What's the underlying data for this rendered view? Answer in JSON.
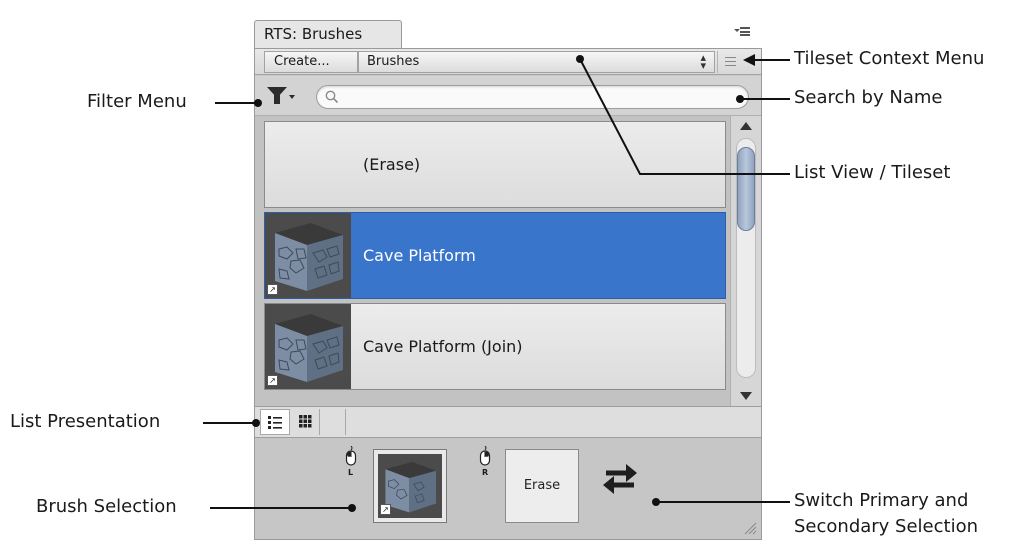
{
  "panel": {
    "tab_title": "RTS: Brushes",
    "toolbar": {
      "create_label": "Create...",
      "tileset_value": "Brushes",
      "select_arrows": "▴▾"
    },
    "search": {
      "placeholder": "",
      "value": ""
    },
    "list_items": [
      {
        "label": "(Erase)",
        "has_thumbnail": false,
        "selected": false
      },
      {
        "label": "Cave Platform",
        "has_thumbnail": true,
        "selected": true
      },
      {
        "label": "Cave Platform (Join)",
        "has_thumbnail": true,
        "selected": false
      }
    ],
    "presentation": {
      "active": "list"
    },
    "brush_selection": {
      "left_mouse": "L",
      "right_mouse": "R",
      "secondary_label": "Erase"
    },
    "thumbnail_badge": "↗"
  },
  "annotations": {
    "tileset_context_menu": "Tileset Context Menu",
    "filter_menu": "Filter Menu",
    "search_by_name": "Search by Name",
    "list_view_tileset": "List View / Tileset",
    "list_presentation": "List Presentation",
    "brush_selection": "Brush Selection",
    "switch_line1": "Switch Primary and",
    "switch_line2": "Secondary Selection"
  },
  "colors": {
    "selected": "#3a75cc",
    "panel_bg": "#c8c8c8",
    "accent_thumb": "#6e7f95"
  }
}
